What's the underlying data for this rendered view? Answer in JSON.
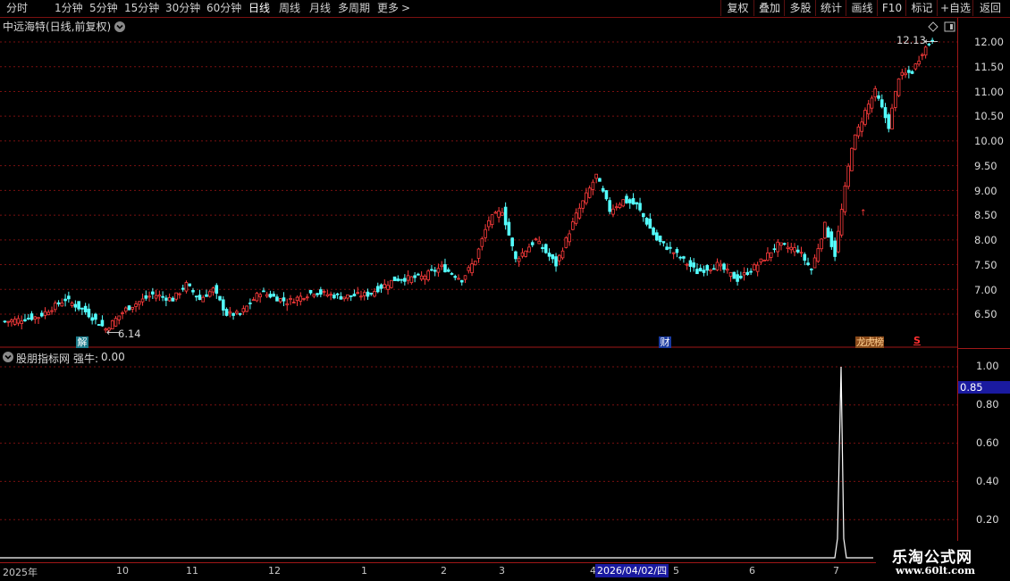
{
  "toolbar": {
    "periods": [
      "分时",
      "1分钟",
      "5分钟",
      "15分钟",
      "30分钟",
      "60分钟",
      "日线",
      "周线",
      "月线",
      "多周期",
      "更多"
    ],
    "active_period": "日线",
    "more_chevron": ">",
    "buttons": [
      "复权",
      "叠加",
      "多股",
      "统计",
      "画线",
      "F10",
      "标记",
      "+自选",
      "返回"
    ]
  },
  "main_chart": {
    "stock_title": "中远海特(日线,前复权)",
    "high_label": "12.13",
    "low_label": "6.14",
    "markers": {
      "jie": "解",
      "cai": "财",
      "longhu": "龙虎榜",
      "s": "S"
    },
    "y_ticks": [
      "12.00",
      "11.50",
      "11.00",
      "10.50",
      "10.00",
      "9.50",
      "9.00",
      "8.50",
      "8.00",
      "7.50",
      "7.00",
      "6.50"
    ]
  },
  "indicator": {
    "title": "股朋指标网",
    "series_label": "强牛:",
    "series_value": "0.00",
    "y_ticks": [
      "1.00",
      "0.80",
      "0.60",
      "0.40",
      "0.20"
    ],
    "current_value_badge": "0.85"
  },
  "date_axis": {
    "labels": [
      "2025年",
      "10",
      "11",
      "12",
      "1",
      "2",
      "3",
      "4",
      "5",
      "6",
      "7"
    ],
    "cursor_date": "2026/04/02/四"
  },
  "watermark": {
    "line1": "乐淘公式网",
    "line2": "www.60lt.com"
  },
  "colors": {
    "up": "#ff3c3c",
    "down": "#54ffff",
    "grid": "#7a1010",
    "badge": "#1a1aa0",
    "indicator_line": "#ffffff"
  },
  "chart_data": {
    "type": "candlestick",
    "price_ylim": [
      6.14,
      12.13
    ],
    "indicator_ylim": [
      0,
      1
    ],
    "indicator_peak": 1.0
  }
}
